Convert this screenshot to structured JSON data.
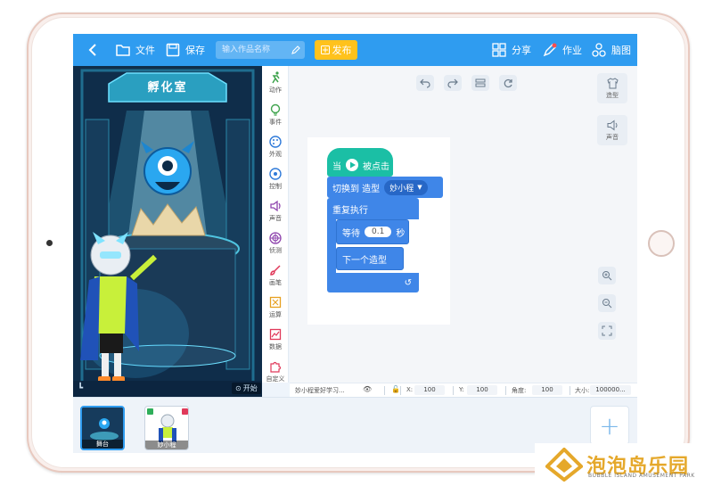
{
  "toolbar": {
    "file_label": "文件",
    "save_label": "保存",
    "name_placeholder": "输入作品名称",
    "publish_label": "发布",
    "share_label": "分享",
    "homework_label": "作业",
    "mindmap_label": "脑图"
  },
  "stage": {
    "banner_text": "孵化室",
    "start_label": "开始"
  },
  "categories": [
    {
      "label": "动作",
      "icon": "run-icon",
      "color": "#3fa34d"
    },
    {
      "label": "事件",
      "icon": "bulb-icon",
      "color": "#3fa34d"
    },
    {
      "label": "外观",
      "icon": "palette-icon",
      "color": "#2f7ad9"
    },
    {
      "label": "控制",
      "icon": "control-icon",
      "color": "#2f7ad9"
    },
    {
      "label": "声音",
      "icon": "speaker-icon",
      "color": "#8e44ad"
    },
    {
      "label": "侦测",
      "icon": "radar-icon",
      "color": "#8e44ad"
    },
    {
      "label": "画笔",
      "icon": "brush-icon",
      "color": "#e0395a"
    },
    {
      "label": "运算",
      "icon": "calc-icon",
      "color": "#e6a020"
    },
    {
      "label": "数据",
      "icon": "chart-icon",
      "color": "#e6a020"
    },
    {
      "label": "自定义",
      "icon": "puzzle-icon",
      "color": "#e0395a"
    }
  ],
  "side_panel": {
    "costume_label": "造型",
    "sound_label": "声音"
  },
  "script": {
    "hat_when": "当",
    "hat_clicked": "被点击",
    "switch_label": "切换到 造型",
    "switch_value": "妙小程",
    "forever_label": "重复执行",
    "wait_label": "等待",
    "wait_value": "0.1",
    "wait_unit": "秒",
    "next_costume_label": "下一个造型"
  },
  "sprite_info": {
    "name": "妙小程爱好学习...",
    "x_label": "X:",
    "x_value": "100",
    "y_label": "Y:",
    "y_value": "100",
    "angle_label": "角度:",
    "angle_value": "100",
    "size_label": "大小:",
    "size_value": "100000..."
  },
  "tray": {
    "stage_thumb_label": "舞台",
    "sprite_thumb_label": "妙小程"
  },
  "watermark": {
    "title": "泡泡岛乐园",
    "subtitle": "BUBBLE ISLAND AMUSEMENT PARK"
  }
}
